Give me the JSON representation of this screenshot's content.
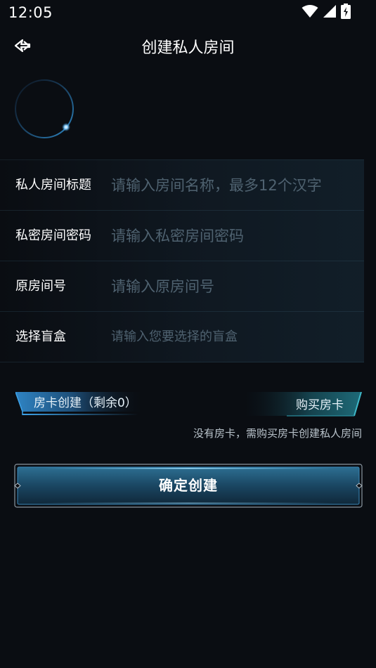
{
  "status_bar": {
    "time": "12:05",
    "icons": [
      "wifi-icon",
      "signal-icon",
      "battery-charging-icon"
    ]
  },
  "nav": {
    "back_icon": "back-arrow-icon",
    "title": "创建私人房间"
  },
  "form": {
    "rows": [
      {
        "label": "私人房间标题",
        "value": "",
        "placeholder": "请输入房间名称，最多12个汉字"
      },
      {
        "label": "私密房间密码",
        "value": "",
        "placeholder": "请输入私密房间密码"
      },
      {
        "label": "原房间号",
        "value": "",
        "placeholder": "请输入原房间号"
      },
      {
        "label": "选择盲盒",
        "value": "",
        "placeholder": "请输入您要选择的盲盒"
      }
    ]
  },
  "cards": {
    "create_label": "房卡创建（剩余0）",
    "buy_label": "购买房卡",
    "hint": "没有房卡，需购买房卡创建私人房间"
  },
  "confirm": {
    "label": "确定创建"
  },
  "colors": {
    "background": "#0a0d12",
    "accent": "#2f8fd0",
    "placeholder": "#4f6270"
  }
}
